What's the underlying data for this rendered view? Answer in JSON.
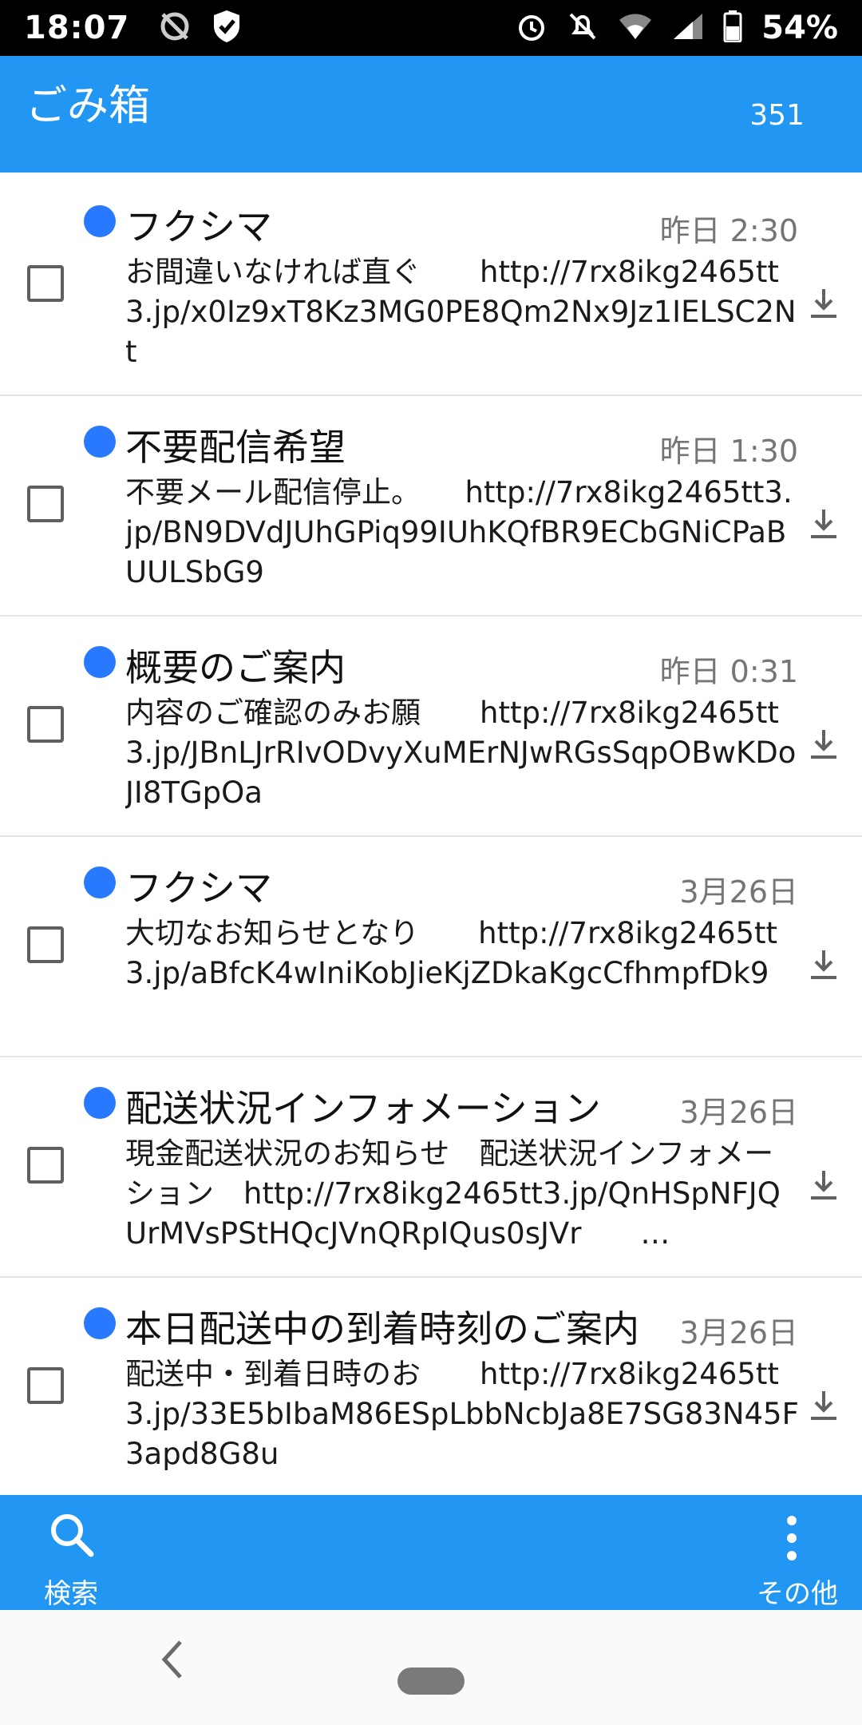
{
  "status_bar": {
    "time": "18:07",
    "battery": "54%",
    "icons_left": [
      "no-sync-icon",
      "shield-icon"
    ],
    "icons_right": [
      "alarm-icon",
      "mute-icon",
      "wifi-icon",
      "signal-icon",
      "battery-icon"
    ]
  },
  "app_bar": {
    "title": "ごみ箱",
    "count": "351",
    "color": "#2196F3"
  },
  "messages": [
    {
      "sender": "フクシマ",
      "date": "昨日 2:30",
      "preview": "お間違いなければ直ぐ　　http://7rx8ikg2465tt3.jp/x0Iz9xT8Kz3MG0PE8Qm2Nx9Jz1IELSC2Nt"
    },
    {
      "sender": "不要配信希望",
      "date": "昨日 1:30",
      "preview": "不要メール配信停止。　　http://7rx8ikg2465tt3.jp/BN9DVdJUhGPiq99IUhKQfBR9ECbGNiCPaBUULSbG9"
    },
    {
      "sender": "概要のご案内",
      "date": "昨日 0:31",
      "preview": "内容のご確認のみお願　　http://7rx8ikg2465tt3.jp/JBnLJrRIvODvyXuMErNJwRGsSqpOBwKDoJI8TGpOa"
    },
    {
      "sender": "フクシマ",
      "date": "3月26日",
      "preview": "大切なお知らせとなり　　http://7rx8ikg2465tt3.jp/aBfcK4wIniKobJieKjZDkaKgcCfhmpfDk9"
    },
    {
      "sender": "配送状況インフォメーション",
      "date": "3月26日",
      "preview": "現金配送状況のお知らせ　配送状況インフォメーション　http://7rx8ikg2465tt3.jp/QnHSpNFJQUrMVsPStHQcJVnQRpIQus0sJVr　　…"
    },
    {
      "sender": "本日配送中の到着時刻のご案内",
      "date": "3月26日",
      "preview": "配送中・到着日時のお　　http://7rx8ikg2465tt3.jp/33E5bIbaM86ESpLbbNcbJa8E7SG83N45F3apd8G8u"
    }
  ],
  "bottom_bar": {
    "search_label": "検索",
    "more_label": "その他"
  }
}
